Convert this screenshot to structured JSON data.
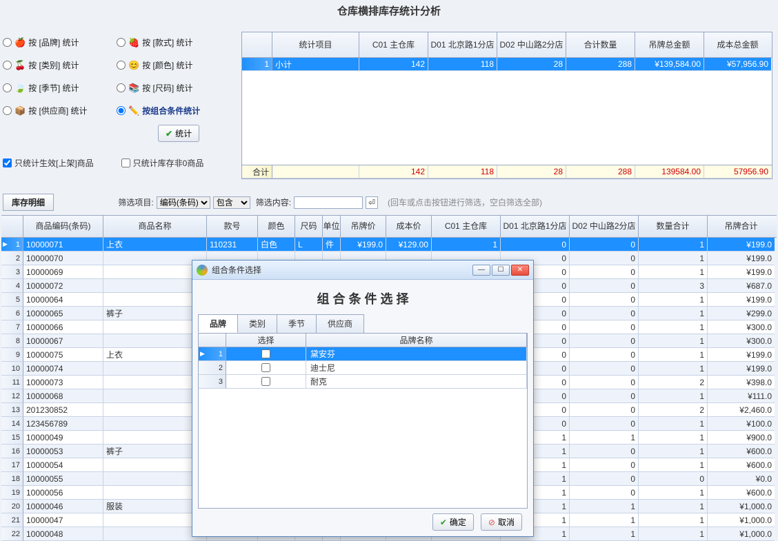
{
  "title": "仓库横排库存统计分析",
  "radios": {
    "brand": "按 [品牌] 统计",
    "style": "按 [款式] 统计",
    "category": "按 [类别] 统计",
    "color": "按 [颜色] 统计",
    "season": "按 [季节] 统计",
    "size": "按 [尺码] 统计",
    "supplier": "按 [供应商] 统计",
    "combo": "按组合条件统计"
  },
  "stat_button": "统计",
  "check1": "只统计生效[上架]商品",
  "check2": "只统计库存非0商品",
  "top": {
    "headers": [
      "统计项目",
      "C01 主仓库",
      "D01 北京路1分店",
      "D02 中山路2分店",
      "合计数量",
      "吊牌总金额",
      "成本总金额"
    ],
    "row": {
      "no": "1",
      "label": "小计",
      "c01": "142",
      "d01": "118",
      "d02": "28",
      "qty": "288",
      "tag": "¥139,584.00",
      "cost": "¥57,956.90"
    },
    "total_label": "合计",
    "total": {
      "c01": "142",
      "d01": "118",
      "d02": "28",
      "qty": "288",
      "tag": "139584.00",
      "cost": "57956.90"
    }
  },
  "tab_label": "库存明细",
  "filter": {
    "label1": "筛选项目:",
    "select1": "编码(条码)",
    "select2": "包含",
    "label2": "筛选内容:",
    "value": "",
    "hint": "(回车或点击按钮进行筛选，空白筛选全部)"
  },
  "detail": {
    "headers": [
      "商品编码(条码)",
      "商品名称",
      "款号",
      "颜色",
      "尺码",
      "单位",
      "吊牌价",
      "成本价",
      "C01 主仓库",
      "D01 北京路1分店",
      "D02 中山路2分店",
      "数量合计",
      "吊牌合计"
    ],
    "rows": [
      {
        "code": "10000071",
        "name": "上衣",
        "style": "110231",
        "color": "白色",
        "size": "L",
        "unit": "件",
        "tag": "¥199.0",
        "cost": "¥129.00",
        "c01": "1",
        "d01": "0",
        "d02": "0",
        "qty": "1",
        "tagsum": "¥199.0"
      },
      {
        "code": "10000070",
        "name": "",
        "style": "",
        "color": "",
        "size": "",
        "unit": "",
        "tag": "",
        "cost": "",
        "c01": "",
        "d01": "0",
        "d02": "0",
        "qty": "1",
        "tagsum": "¥199.0"
      },
      {
        "code": "10000069",
        "name": "",
        "style": "",
        "color": "",
        "size": "",
        "unit": "",
        "tag": "",
        "cost": "",
        "c01": "",
        "d01": "0",
        "d02": "0",
        "qty": "1",
        "tagsum": "¥199.0"
      },
      {
        "code": "10000072",
        "name": "",
        "style": "",
        "color": "",
        "size": "",
        "unit": "",
        "tag": "",
        "cost": "",
        "c01": "",
        "d01": "0",
        "d02": "0",
        "qty": "3",
        "tagsum": "¥687.0"
      },
      {
        "code": "10000064",
        "name": "",
        "style": "",
        "color": "",
        "size": "",
        "unit": "",
        "tag": "",
        "cost": "",
        "c01": "",
        "d01": "0",
        "d02": "0",
        "qty": "1",
        "tagsum": "¥199.0"
      },
      {
        "code": "10000065",
        "name": "裤子",
        "style": "",
        "color": "",
        "size": "",
        "unit": "",
        "tag": "",
        "cost": "",
        "c01": "",
        "d01": "0",
        "d02": "0",
        "qty": "1",
        "tagsum": "¥299.0"
      },
      {
        "code": "10000066",
        "name": "",
        "style": "",
        "color": "",
        "size": "",
        "unit": "",
        "tag": "",
        "cost": "",
        "c01": "",
        "d01": "0",
        "d02": "0",
        "qty": "1",
        "tagsum": "¥300.0"
      },
      {
        "code": "10000067",
        "name": "",
        "style": "",
        "color": "",
        "size": "",
        "unit": "",
        "tag": "",
        "cost": "",
        "c01": "",
        "d01": "0",
        "d02": "0",
        "qty": "1",
        "tagsum": "¥300.0"
      },
      {
        "code": "10000075",
        "name": "上衣",
        "style": "",
        "color": "",
        "size": "",
        "unit": "",
        "tag": "",
        "cost": "",
        "c01": "",
        "d01": "0",
        "d02": "0",
        "qty": "1",
        "tagsum": "¥199.0"
      },
      {
        "code": "10000074",
        "name": "",
        "style": "",
        "color": "",
        "size": "",
        "unit": "",
        "tag": "",
        "cost": "",
        "c01": "",
        "d01": "0",
        "d02": "0",
        "qty": "1",
        "tagsum": "¥199.0"
      },
      {
        "code": "10000073",
        "name": "",
        "style": "",
        "color": "",
        "size": "",
        "unit": "",
        "tag": "",
        "cost": "",
        "c01": "",
        "d01": "0",
        "d02": "0",
        "qty": "2",
        "tagsum": "¥398.0"
      },
      {
        "code": "10000068",
        "name": "",
        "style": "",
        "color": "",
        "size": "",
        "unit": "",
        "tag": "",
        "cost": "",
        "c01": "",
        "d01": "0",
        "d02": "0",
        "qty": "1",
        "tagsum": "¥111.0"
      },
      {
        "code": "201230852",
        "name": "",
        "style": "",
        "color": "",
        "size": "",
        "unit": "",
        "tag": "",
        "cost": "",
        "c01": "",
        "d01": "0",
        "d02": "0",
        "qty": "2",
        "tagsum": "¥2,460.0"
      },
      {
        "code": "123456789",
        "name": "",
        "style": "",
        "color": "",
        "size": "",
        "unit": "",
        "tag": "",
        "cost": "",
        "c01": "",
        "d01": "0",
        "d02": "0",
        "qty": "1",
        "tagsum": "¥100.0"
      },
      {
        "code": "10000049",
        "name": "",
        "style": "",
        "color": "",
        "size": "",
        "unit": "",
        "tag": "",
        "cost": "",
        "c01": "",
        "d01": "1",
        "d02": "1",
        "qty": "1",
        "tagsum": "¥900.0"
      },
      {
        "code": "10000053",
        "name": "裤子",
        "style": "",
        "color": "",
        "size": "",
        "unit": "",
        "tag": "",
        "cost": "",
        "c01": "",
        "d01": "1",
        "d02": "0",
        "qty": "1",
        "tagsum": "¥600.0"
      },
      {
        "code": "10000054",
        "name": "",
        "style": "",
        "color": "",
        "size": "",
        "unit": "",
        "tag": "",
        "cost": "",
        "c01": "",
        "d01": "1",
        "d02": "0",
        "qty": "1",
        "tagsum": "¥600.0"
      },
      {
        "code": "10000055",
        "name": "",
        "style": "",
        "color": "",
        "size": "",
        "unit": "",
        "tag": "",
        "cost": "",
        "c01": "",
        "d01": "1",
        "d02": "0",
        "qty": "0",
        "tagsum": "¥0.0"
      },
      {
        "code": "10000056",
        "name": "",
        "style": "",
        "color": "",
        "size": "",
        "unit": "",
        "tag": "",
        "cost": "",
        "c01": "",
        "d01": "1",
        "d02": "0",
        "qty": "1",
        "tagsum": "¥600.0"
      },
      {
        "code": "10000046",
        "name": "服装",
        "style": "",
        "color": "",
        "size": "",
        "unit": "",
        "tag": "",
        "cost": "",
        "c01": "",
        "d01": "1",
        "d02": "1",
        "qty": "1",
        "tagsum": "¥1,000.0"
      },
      {
        "code": "10000047",
        "name": "",
        "style": "",
        "color": "",
        "size": "",
        "unit": "",
        "tag": "",
        "cost": "",
        "c01": "",
        "d01": "1",
        "d02": "1",
        "qty": "1",
        "tagsum": "¥1,000.0"
      },
      {
        "code": "10000048",
        "name": "",
        "style": "",
        "color": "",
        "size": "",
        "unit": "",
        "tag": "",
        "cost": "",
        "c01": "",
        "d01": "1",
        "d02": "1",
        "qty": "1",
        "tagsum": "¥1,000.0"
      }
    ]
  },
  "dialog": {
    "win_title": "组合条件选择",
    "big_title": "组 合 条 件 选 择",
    "tabs": [
      "品牌",
      "类别",
      "季节",
      "供应商"
    ],
    "headers": [
      "选择",
      "品牌名称"
    ],
    "rows": [
      {
        "no": "1",
        "name": "黛安芬"
      },
      {
        "no": "2",
        "name": "迪士尼"
      },
      {
        "no": "3",
        "name": "耐克"
      }
    ],
    "ok": "确定",
    "cancel": "取消"
  }
}
